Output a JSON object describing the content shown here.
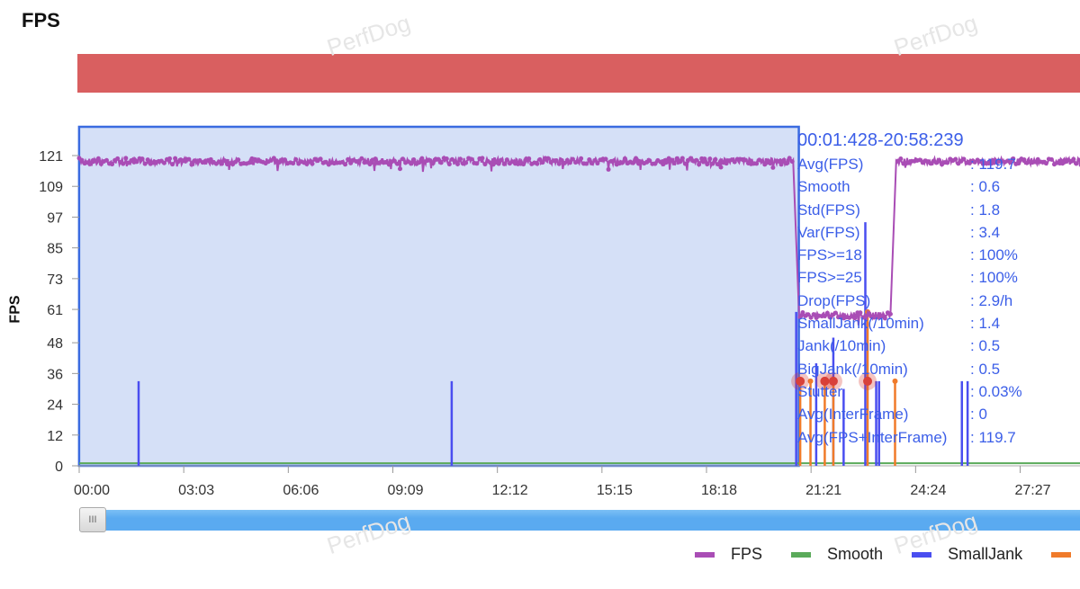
{
  "title": "FPS",
  "watermark": "PerfDog",
  "stats": {
    "range": "00:01:428-20:58:239",
    "rows": [
      {
        "k": "Avg(FPS)",
        "v": ": 119.7"
      },
      {
        "k": "Smooth",
        "v": ": 0.6"
      },
      {
        "k": "Std(FPS)",
        "v": ": 1.8"
      },
      {
        "k": "Var(FPS)",
        "v": ": 3.4"
      },
      {
        "k": "FPS>=18",
        "v": ": 100%"
      },
      {
        "k": "FPS>=25",
        "v": ": 100%"
      },
      {
        "k": "Drop(FPS)",
        "v": ": 2.9/h"
      },
      {
        "k": "SmallJank(/10min)",
        "v": ": 1.4"
      },
      {
        "k": "Jank(/10min)",
        "v": ": 0.5"
      },
      {
        "k": "BigJank(/10min)",
        "v": ": 0.5"
      },
      {
        "k": "Stutter",
        "v": ": 0.03%"
      },
      {
        "k": "Avg(InterFrame)",
        "v": ": 0"
      },
      {
        "k": "Avg(FPS+InterFrame)",
        "v": ": 119.7"
      }
    ]
  },
  "slider": {
    "handle_label": "III"
  },
  "chart_data": {
    "type": "line",
    "ylabel": "FPS",
    "ylim": [
      0,
      121
    ],
    "yticks": [
      "0",
      "12",
      "24",
      "36",
      "48",
      "61",
      "73",
      "85",
      "97",
      "109",
      "121"
    ],
    "xticks": [
      "00:00",
      "03:03",
      "06:06",
      "09:09",
      "12:12",
      "15:15",
      "18:18",
      "21:21",
      "24:24",
      "27:27"
    ],
    "x_tick_seconds": [
      0,
      183,
      366,
      549,
      732,
      915,
      1098,
      1281,
      1464,
      1647
    ],
    "selection": {
      "from": "00:01",
      "to": "20:58"
    },
    "series": [
      {
        "name": "FPS",
        "color": "#a94db5",
        "segments": [
          {
            "from_s": 0,
            "to_s": 1250,
            "fps": 120
          },
          {
            "from_s": 1260,
            "to_s": 1420,
            "fps": 60
          },
          {
            "from_s": 1430,
            "to_s": 1760,
            "fps": 120
          }
        ]
      },
      {
        "name": "Smooth",
        "color": "#5aaa5a",
        "level": 1
      },
      {
        "name": "SmallJank",
        "color": "#4a4ef0",
        "spikes_s": [
          104,
          652,
          1255,
          1290,
          1320,
          1338,
          1376,
          1395,
          1400,
          1545,
          1555
        ],
        "spike_values": [
          33,
          33,
          60,
          40,
          50,
          30,
          95,
          33,
          33,
          33,
          33
        ]
      },
      {
        "name": "Jank",
        "color": "#f07b2a",
        "spikes_s": [
          1262,
          1280,
          1305,
          1320,
          1380,
          1428
        ],
        "spike_values": [
          33,
          33,
          33,
          33,
          60,
          33
        ]
      }
    ],
    "legend": [
      "FPS",
      "Smooth",
      "SmallJank"
    ],
    "legend_position": "bottom-right"
  }
}
